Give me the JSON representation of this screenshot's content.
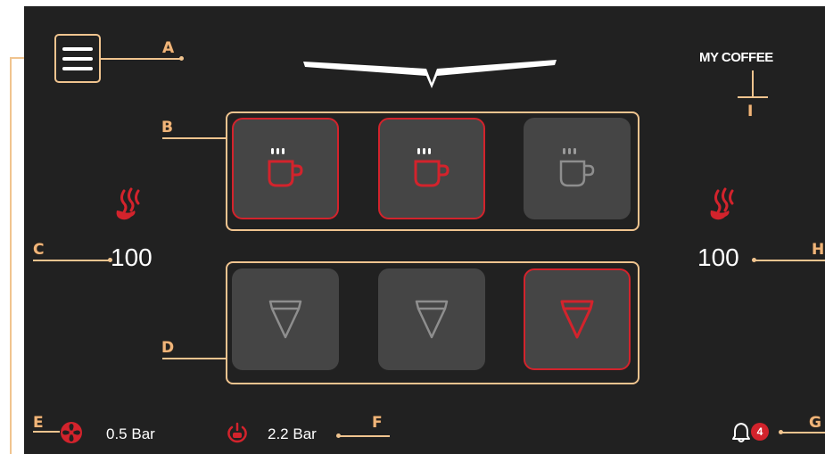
{
  "header": {
    "title": "MY COFFEE"
  },
  "callouts": {
    "a": "A",
    "b": "B",
    "c": "C",
    "d": "D",
    "e": "E",
    "f": "F",
    "g": "G",
    "h": "H",
    "i": "I"
  },
  "steam": {
    "left_value": "100",
    "right_value": "100"
  },
  "pressure": {
    "boiler_value": "0.5 Bar",
    "brew_value": "2.2 Bar"
  },
  "notifications": {
    "count": "4"
  },
  "cup_tiles": [
    {
      "name": "single",
      "state": "selected"
    },
    {
      "name": "double",
      "state": "selected"
    },
    {
      "name": "third",
      "state": "inactive"
    }
  ],
  "filter_tiles": [
    {
      "name": "filter-1",
      "state": "inactive"
    },
    {
      "name": "filter-2",
      "state": "inactive"
    },
    {
      "name": "filter-3",
      "state": "selected"
    }
  ],
  "colors": {
    "accent": "#d3232c",
    "callout": "#f0b57a",
    "background": "#212121",
    "tile": "#454545"
  },
  "icons": [
    "menu-icon",
    "steam-icon",
    "cup-icon",
    "filter-icon",
    "fan-icon",
    "brew-group-icon",
    "bell-icon",
    "chevron-down-icon"
  ]
}
